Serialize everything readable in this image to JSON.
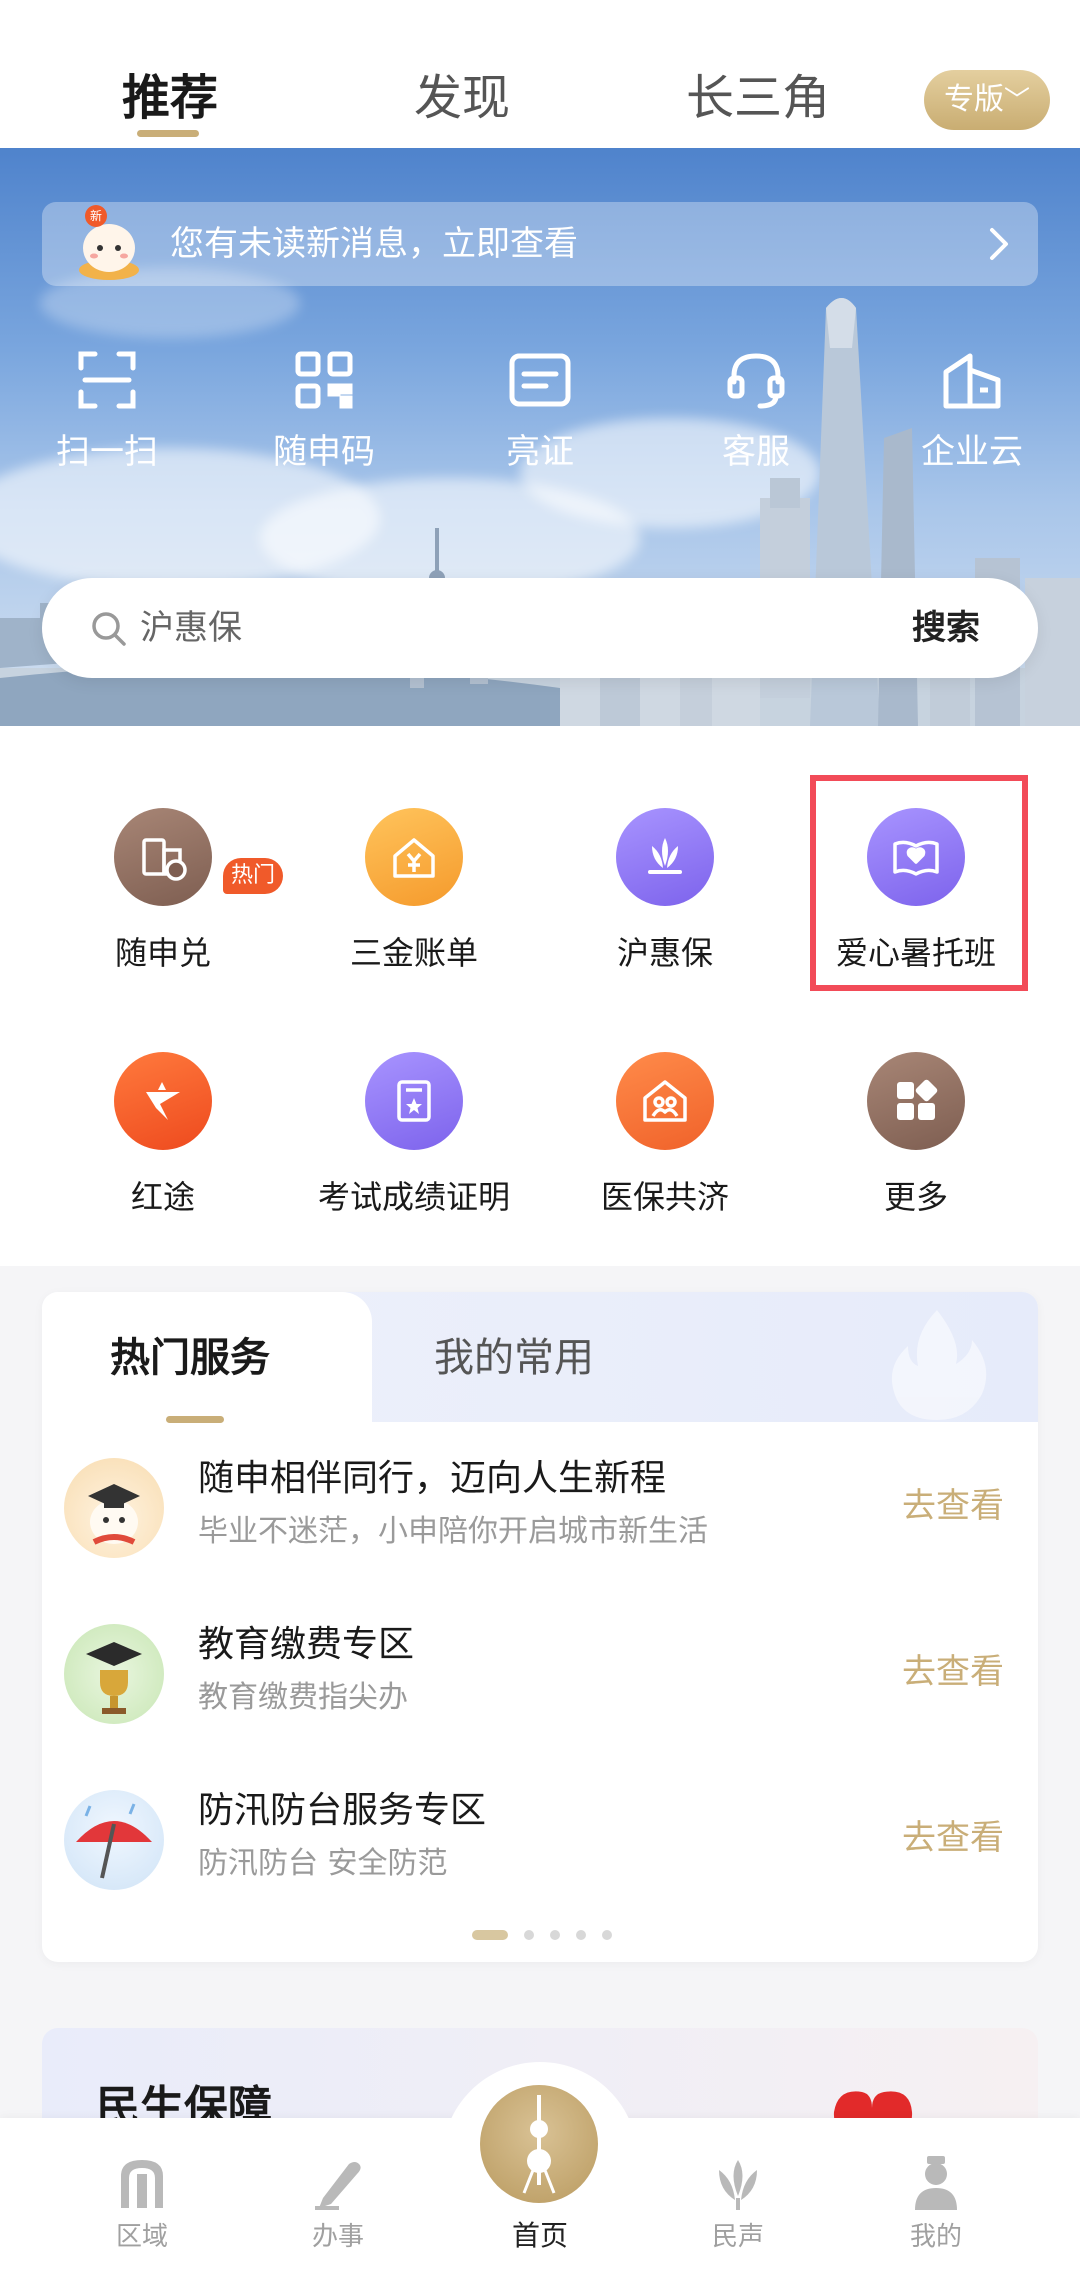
{
  "top_tabs": {
    "items": [
      "推荐",
      "发现",
      "长三角"
    ],
    "edition": "专版"
  },
  "hero": {
    "notice_badge": "新",
    "notice_text": "您有未读新消息，立即查看",
    "quick_actions": [
      "扫一扫",
      "随申码",
      "亮证",
      "客服",
      "企业云"
    ],
    "search_placeholder": "沪惠保",
    "search_button": "搜索"
  },
  "services": {
    "items": [
      "随申兑",
      "三金账单",
      "沪惠保",
      "爱心暑托班",
      "红途",
      "考试成绩证明",
      "医保共济",
      "更多"
    ],
    "hot_badge": "热门",
    "colors": {
      "brown": "#8b6a5c",
      "orange": "#f6a93b",
      "purple": "#8a73f0",
      "red": "#f0532a",
      "highlight": "#f24b58"
    }
  },
  "hot_services": {
    "tabs": [
      "热门服务",
      "我的常用"
    ],
    "link_label": "去查看",
    "rows": [
      {
        "title": "随申相伴同行，迈向人生新程",
        "subtitle": "毕业不迷茫，小申陪你开启城市新生活"
      },
      {
        "title": "教育缴费专区",
        "subtitle": "教育缴费指尖办"
      },
      {
        "title": "防汛防台服务专区",
        "subtitle": "防汛防台 安全防范"
      }
    ],
    "page_count": 5,
    "active_page": 1
  },
  "promo": {
    "title": "民生保障"
  },
  "bottom_nav": {
    "items": [
      "区域",
      "办事",
      "首页",
      "民声",
      "我的"
    ],
    "active": "首页",
    "accent": "#c9ae78"
  }
}
